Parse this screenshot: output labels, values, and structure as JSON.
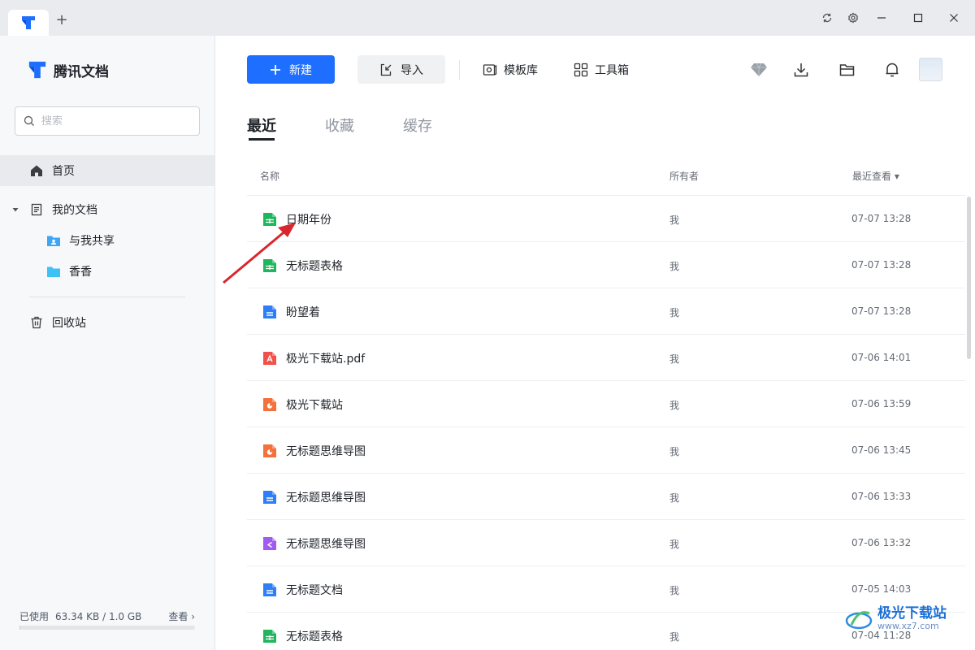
{
  "app": {
    "brand_name": "腾讯文档",
    "new_tab_symbol": "+"
  },
  "window_controls": [
    "sync-icon",
    "settings-icon",
    "minimize-icon",
    "maximize-icon",
    "close-icon"
  ],
  "sidebar": {
    "search_placeholder": "搜索",
    "nav": {
      "home": "首页",
      "my_docs": "我的文档",
      "shared_with_me": "与我共享",
      "folder_xiangxiang": "香香",
      "trash": "回收站"
    },
    "storage": {
      "label": "已使用",
      "value": "63.34 KB / 1.0 GB",
      "view_link": "查看 ›",
      "used_fraction": 0.0001
    }
  },
  "toolbar": {
    "new_label": "新建",
    "import_label": "导入",
    "templates_label": "模板库",
    "toolbox_label": "工具箱"
  },
  "tabs": {
    "recent": "最近",
    "favorites": "收藏",
    "cache": "缓存"
  },
  "table": {
    "headers": {
      "name": "名称",
      "owner": "所有者",
      "last_viewed": "最近查看 ▾"
    },
    "rows": [
      {
        "type": "sheet",
        "name": "日期年份",
        "owner": "我",
        "time": "07-07 13:28"
      },
      {
        "type": "sheet",
        "name": "无标题表格",
        "owner": "我",
        "time": "07-07 13:28"
      },
      {
        "type": "doc",
        "name": "盼望着",
        "owner": "我",
        "time": "07-07 13:28"
      },
      {
        "type": "pdf",
        "name": "极光下载站.pdf",
        "owner": "我",
        "time": "07-06 14:01"
      },
      {
        "type": "slide",
        "name": "极光下载站",
        "owner": "我",
        "time": "07-06 13:59"
      },
      {
        "type": "slide",
        "name": "无标题思维导图",
        "owner": "我",
        "time": "07-06 13:45"
      },
      {
        "type": "doc",
        "name": "无标题思维导图",
        "owner": "我",
        "time": "07-06 13:33"
      },
      {
        "type": "mind",
        "name": "无标题思维导图",
        "owner": "我",
        "time": "07-06 13:32"
      },
      {
        "type": "doc",
        "name": "无标题文档",
        "owner": "我",
        "time": "07-05 14:03"
      },
      {
        "type": "sheet",
        "name": "无标题表格",
        "owner": "我",
        "time": "07-04 11:28"
      }
    ]
  },
  "file_type_colors": {
    "sheet": "#20b65e",
    "doc": "#2d7ef7",
    "pdf": "#f0524b",
    "slide": "#f5713c",
    "mind": "#a05cf0"
  },
  "watermark": {
    "text": "极光下载站",
    "sub": "www.xz7.com"
  }
}
